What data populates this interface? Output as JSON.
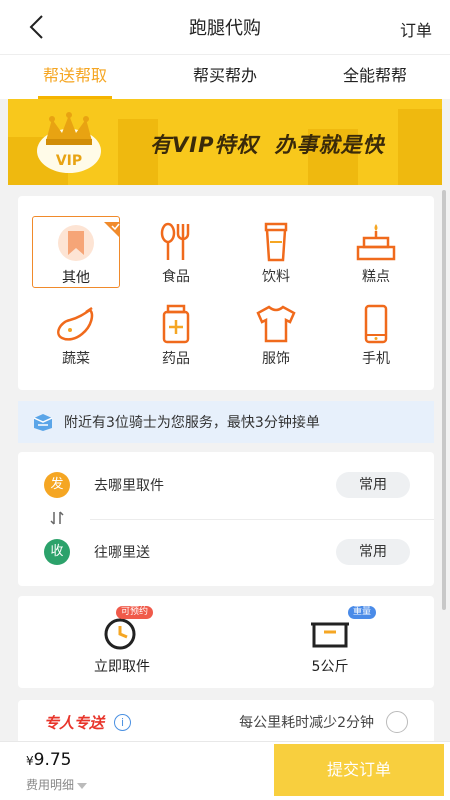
{
  "header": {
    "title": "跑腿代购",
    "orders_label": "订单"
  },
  "tabs": [
    {
      "label": "帮送帮取",
      "active": true
    },
    {
      "label": "帮买帮办",
      "active": false
    },
    {
      "label": "全能帮帮",
      "active": false
    }
  ],
  "banner": {
    "badge": "VIP",
    "slogan_a": "有VIP特权",
    "slogan_b": "办事就是快"
  },
  "categories": [
    {
      "label": "其他",
      "icon": "bookmark-icon",
      "selected": true
    },
    {
      "label": "食品",
      "icon": "spoon-fork-icon",
      "selected": false
    },
    {
      "label": "饮料",
      "icon": "cup-icon",
      "selected": false
    },
    {
      "label": "糕点",
      "icon": "cake-icon",
      "selected": false
    },
    {
      "label": "蔬菜",
      "icon": "eggplant-icon",
      "selected": false
    },
    {
      "label": "药品",
      "icon": "medicine-bottle-icon",
      "selected": false
    },
    {
      "label": "服饰",
      "icon": "tshirt-icon",
      "selected": false
    },
    {
      "label": "手机",
      "icon": "phone-icon",
      "selected": false
    }
  ],
  "rider_notice": "附近有3位骑士为您服务，最快3分钟接单",
  "address": {
    "pickup": {
      "badge": "发",
      "text": "去哪里取件",
      "button": "常用"
    },
    "dropoff": {
      "badge": "收",
      "text": "往哪里送",
      "button": "常用"
    }
  },
  "options": {
    "time": {
      "label": "立即取件",
      "badge": "可预约"
    },
    "weight": {
      "label": "5公斤",
      "badge": "重量"
    }
  },
  "express": {
    "name": "专人专送",
    "info": "i",
    "desc": "每公里耗时减少2分钟"
  },
  "footer": {
    "currency": "¥",
    "price": "9.75",
    "fee_detail": "费用明细",
    "submit": "提交订单"
  },
  "colors": {
    "accent": "#f5a623",
    "banner": "#f8c81c",
    "icon_orange": "#f06a1c",
    "pickup": "#f5a623",
    "dropoff": "#2ca26b",
    "submit": "#f8cf3e"
  }
}
